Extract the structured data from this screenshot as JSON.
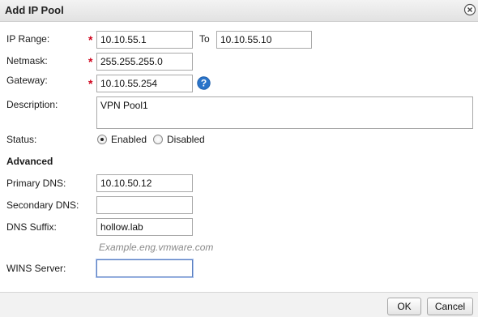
{
  "dialog": {
    "title": "Add IP Pool"
  },
  "labels": {
    "ip_range": "IP Range:",
    "to": "To",
    "netmask": "Netmask:",
    "gateway": "Gateway:",
    "description": "Description:",
    "status": "Status:",
    "advanced": "Advanced",
    "primary_dns": "Primary DNS:",
    "secondary_dns": "Secondary DNS:",
    "dns_suffix": "DNS Suffix:",
    "wins_server": "WINS Server:"
  },
  "required_marker": "*",
  "fields": {
    "ip_range_start": "10.10.55.1",
    "ip_range_end": "10.10.55.10",
    "netmask": "255.255.255.0",
    "gateway": "10.10.55.254",
    "description": "VPN Pool1",
    "primary_dns": "10.10.50.12",
    "secondary_dns": "",
    "dns_suffix": "hollow.lab",
    "wins_server": ""
  },
  "dns_suffix_hint": "Example.eng.vmware.com",
  "status": {
    "enabled_label": "Enabled",
    "disabled_label": "Disabled",
    "selected": "Enabled"
  },
  "buttons": {
    "ok": "OK",
    "cancel": "Cancel"
  },
  "icons": {
    "close": "close-icon",
    "help": "help-icon"
  },
  "colors": {
    "required": "#d0021b",
    "help_icon": "#2a74c9"
  }
}
